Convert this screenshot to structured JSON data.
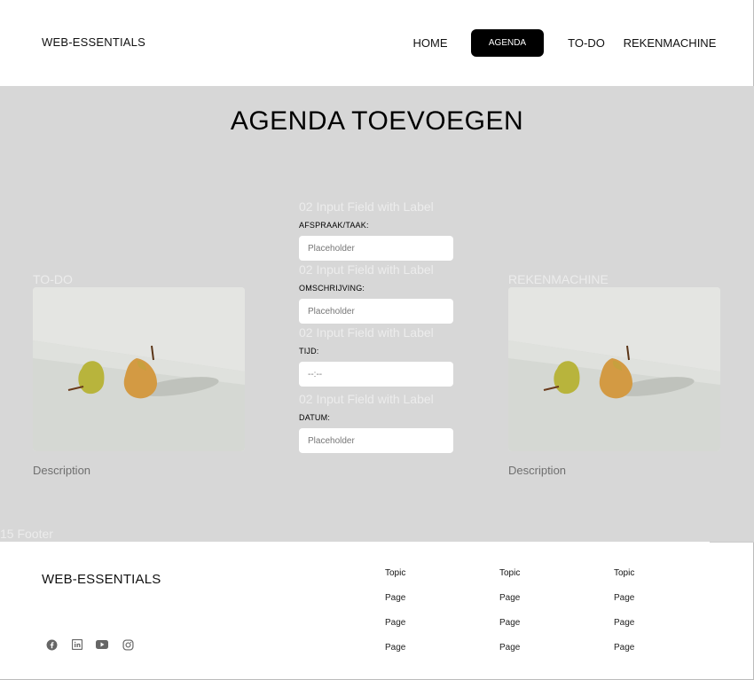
{
  "header": {
    "logo": "WEB-ESSENTIALS",
    "nav": [
      {
        "label": "HOME",
        "active": false
      },
      {
        "label": "AGENDA",
        "active": true
      },
      {
        "label": "TO-DO",
        "active": false
      },
      {
        "label": "REKENMACHINE",
        "active": false
      }
    ]
  },
  "main": {
    "title": "AGENDA TOEVOEGEN",
    "left_card": {
      "heading": "TO-DO",
      "description": "Description"
    },
    "right_card": {
      "heading": "REKENMACHINE",
      "description": "Description"
    },
    "form": {
      "fields": [
        {
          "ghost": "02 Input Field with Label",
          "label": "AFSPRAAK/TAAK:",
          "placeholder": "Placeholder"
        },
        {
          "ghost": "02 Input Field with Label",
          "label": "OMSCHRIJVING:",
          "placeholder": "Placeholder"
        },
        {
          "ghost": "02 Input Field with Label",
          "label": "TIJD:",
          "placeholder": "--:--"
        },
        {
          "ghost": "02 Input Field with Label",
          "label": "DATUM:",
          "placeholder": "Placeholder"
        }
      ]
    },
    "footer_ghost": "15 Footer"
  },
  "footer": {
    "logo": "WEB-ESSENTIALS",
    "social_icons": [
      "facebook-icon",
      "linkedin-icon",
      "youtube-icon",
      "instagram-icon"
    ],
    "columns": [
      {
        "topic": "Topic",
        "pages": [
          "Page",
          "Page",
          "Page"
        ]
      },
      {
        "topic": "Topic",
        "pages": [
          "Page",
          "Page",
          "Page"
        ]
      },
      {
        "topic": "Topic",
        "pages": [
          "Page",
          "Page",
          "Page"
        ]
      }
    ]
  },
  "colors": {
    "main_background": "#d7d7d7",
    "active_nav_background": "#000000",
    "ghost_text": "#ececec"
  }
}
